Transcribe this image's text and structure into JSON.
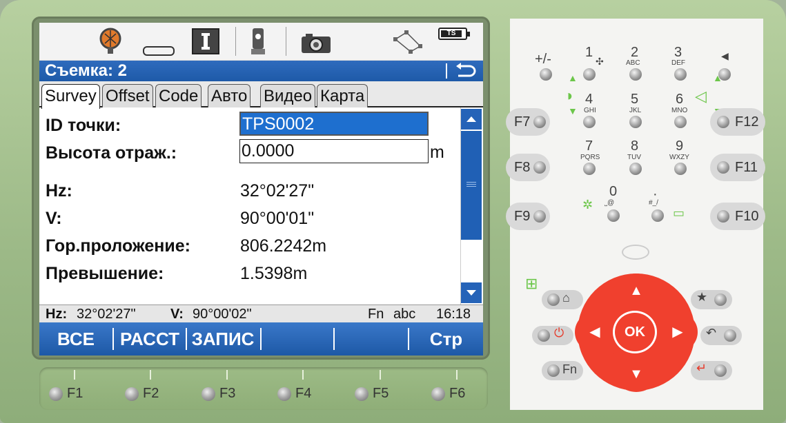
{
  "titlebar": {
    "title": "Съемка: 2"
  },
  "tabs": [
    {
      "label": "Survey",
      "active": true
    },
    {
      "label": "Offset"
    },
    {
      "label": "Code"
    },
    {
      "label": "Авто"
    },
    {
      "label": "Видео"
    },
    {
      "label": "Карта"
    }
  ],
  "fields": {
    "point_id": {
      "label": "ID точки:",
      "value": "TPS0002"
    },
    "reflector_height": {
      "label": "Высота отраж.:",
      "value": "0.0000",
      "unit": "m"
    }
  },
  "readings": [
    {
      "label": "Hz:",
      "value": "32°02'27\""
    },
    {
      "label": "V:",
      "value": "90°00'01\""
    },
    {
      "label": "Гор.проложение:",
      "value": "806.2242m"
    },
    {
      "label": "Превышение:",
      "value": "1.5398m"
    }
  ],
  "statusbar": {
    "hz_label": "Hz:",
    "hz_value": "32°02'27\"",
    "v_label": "V:",
    "v_value": "90°00'02\"",
    "fn": "Fn",
    "input_mode": "abc",
    "time": "16:18"
  },
  "iconbar": {
    "battery_label": "TS"
  },
  "softkeys": [
    "ВСЕ",
    "РАССТ",
    "ЗАПИС",
    "",
    "",
    "Стр"
  ],
  "fkeys": [
    "F1",
    "F2",
    "F3",
    "F4",
    "F5",
    "F6"
  ],
  "keypad": {
    "plusminus": "+/-",
    "digits": [
      {
        "num": "1",
        "sub": ""
      },
      {
        "num": "2",
        "sub": "ABC"
      },
      {
        "num": "3",
        "sub": "DEF"
      },
      {
        "num": "4",
        "sub": "GHI"
      },
      {
        "num": "5",
        "sub": "JKL"
      },
      {
        "num": "6",
        "sub": "MNO"
      },
      {
        "num": "7",
        "sub": "PQRS"
      },
      {
        "num": "8",
        "sub": "TUV"
      },
      {
        "num": "9",
        "sub": "WXZY"
      },
      {
        "num": "0",
        "sub": "˽@"
      },
      {
        "num": "·",
        "sub": "#_/"
      }
    ],
    "side_fkeys": [
      "F7",
      "F8",
      "F9",
      "F12",
      "F11",
      "F10"
    ],
    "ok": "OK",
    "fn": "Fn"
  },
  "colors": {
    "accent_blue": "#1e5aa8",
    "selection_blue": "#1e6fcf",
    "device_green": "#9cb987",
    "nav_red": "#f0402e"
  }
}
